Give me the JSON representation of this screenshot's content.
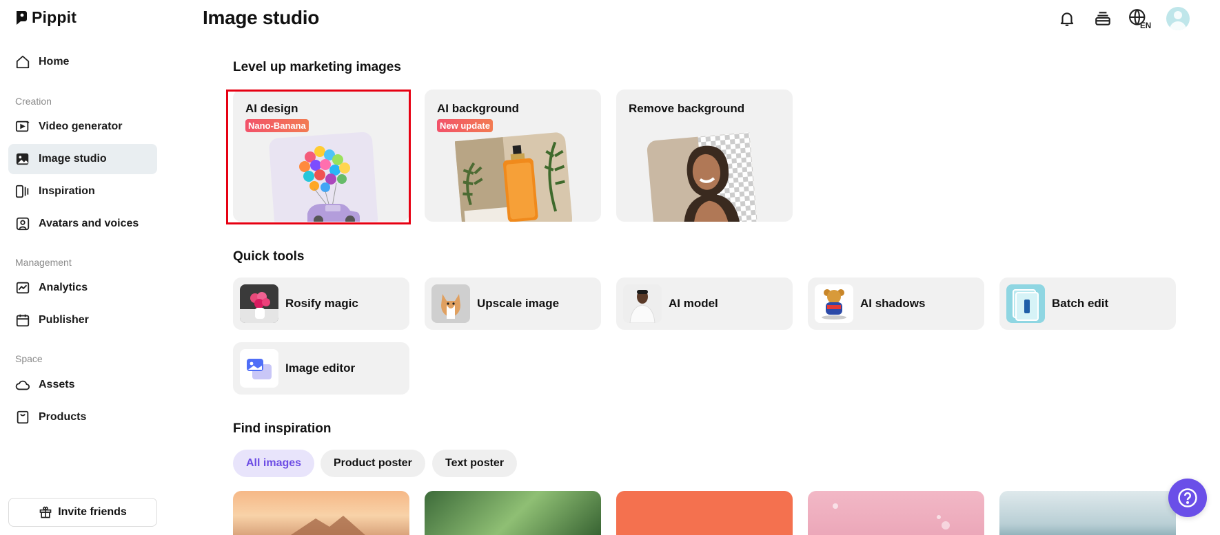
{
  "brand": {
    "name": "Pippit"
  },
  "sidebar": {
    "home": "Home",
    "sections": {
      "creation": "Creation",
      "management": "Management",
      "space": "Space"
    },
    "items": {
      "video_generator": "Video generator",
      "image_studio": "Image studio",
      "inspiration": "Inspiration",
      "avatars": "Avatars and voices",
      "analytics": "Analytics",
      "publisher": "Publisher",
      "assets": "Assets",
      "products": "Products"
    },
    "active": "image_studio",
    "invite": "Invite friends"
  },
  "header": {
    "title": "Image studio",
    "language": "EN",
    "icons": [
      "bell-icon",
      "layers-icon",
      "globe-icon",
      "avatar"
    ]
  },
  "marketing": {
    "heading": "Level up marketing images",
    "cards": [
      {
        "title": "AI design",
        "badge": "Nano-Banana"
      },
      {
        "title": "AI background",
        "badge": "New update"
      },
      {
        "title": "Remove background",
        "badge": ""
      }
    ]
  },
  "quick_tools": {
    "heading": "Quick tools",
    "items": [
      "Rosify magic",
      "Upscale image",
      "AI model",
      "AI shadows",
      "Batch edit",
      "Image editor"
    ]
  },
  "inspiration": {
    "heading": "Find inspiration",
    "chips": [
      "All images",
      "Product poster",
      "Text poster"
    ],
    "active_chip": "All images"
  },
  "colors": {
    "accent": "#6a4fe8",
    "active_nav_bg": "#e9eef1",
    "highlight": "#e60012",
    "badge": "#f2526a"
  }
}
